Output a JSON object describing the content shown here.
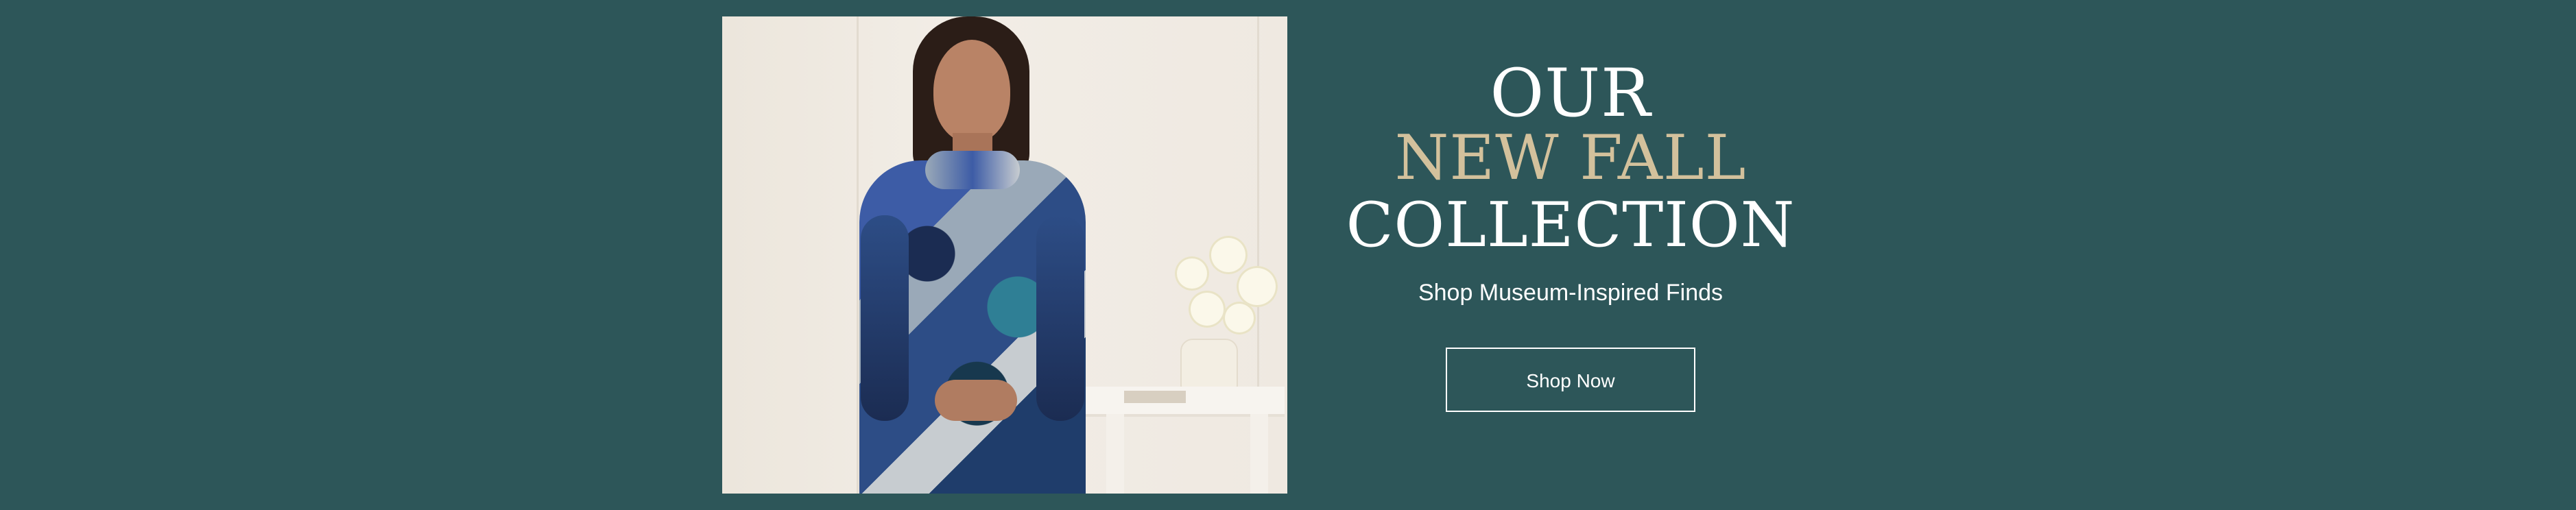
{
  "colors": {
    "background": "#2d5659",
    "headline_white": "#ffffff",
    "headline_accent": "#d3c19c",
    "button_border": "#ffffff"
  },
  "hero": {
    "headline": {
      "line1": "OUR",
      "line2": "NEW FALL",
      "line3": "COLLECTION"
    },
    "subheadline": "Shop Museum-Inspired Finds",
    "cta_label": "Shop Now"
  }
}
